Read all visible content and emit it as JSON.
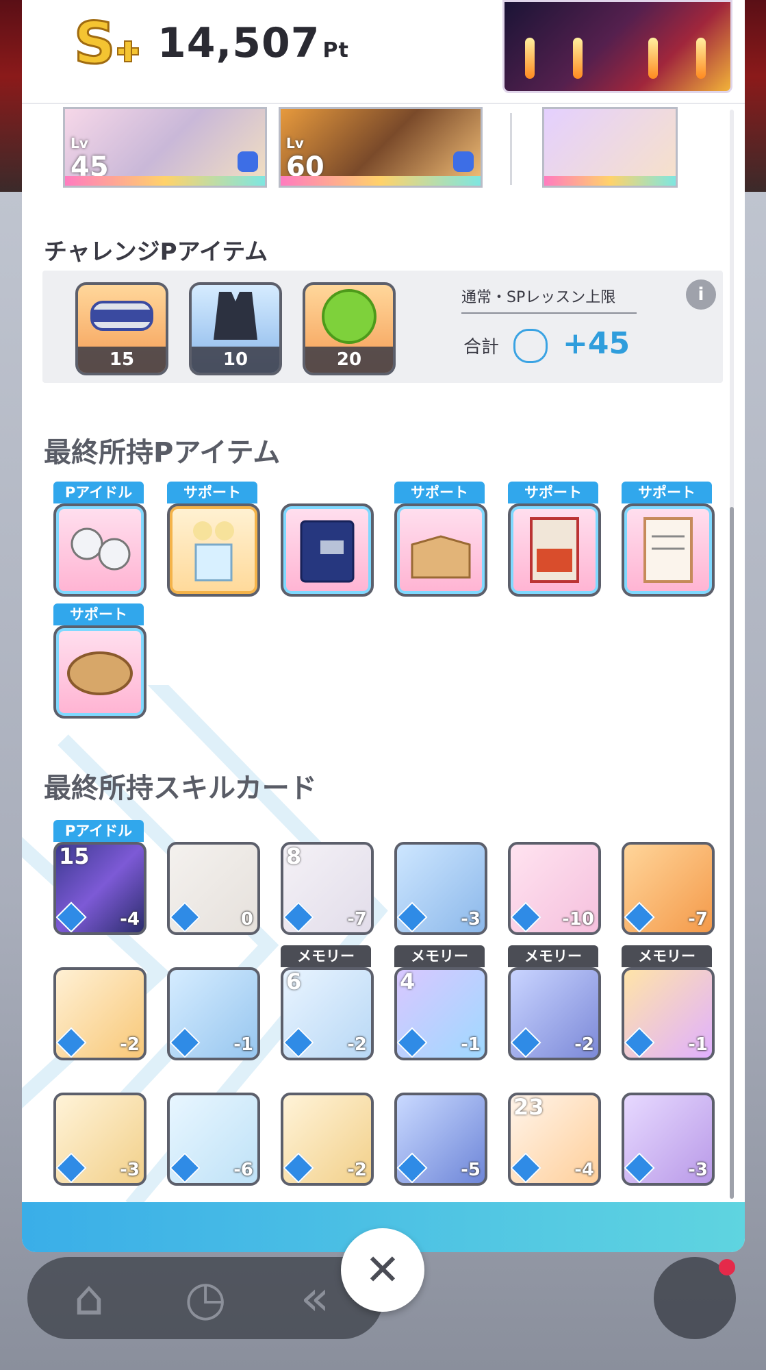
{
  "header": {
    "rank": "S+",
    "points": "14,507",
    "points_unit": "Pt"
  },
  "card_strip": [
    {
      "lv_label": "Lv",
      "level": "45"
    },
    {
      "lv_label": "Lv",
      "level": "60"
    }
  ],
  "challenge": {
    "title": "チャレンジPアイテム",
    "items": [
      {
        "count": "15"
      },
      {
        "count": "10"
      },
      {
        "count": "20"
      }
    ],
    "limit_label": "通常・SPレッスン上限",
    "total_label": "合計",
    "total_value": "+45"
  },
  "final_items": {
    "title": "最終所持Pアイテム",
    "labels": [
      "Pアイドル",
      "サポート",
      "",
      "サポート",
      "サポート",
      "サポート",
      "サポート"
    ]
  },
  "final_skills": {
    "title": "最終所持スキルカード",
    "top_labels": [
      "Pアイドル",
      "メモリー",
      "メモリー",
      "メモリー",
      "メモリー"
    ],
    "cards": [
      {
        "lvl": "15",
        "cost": "-4"
      },
      {
        "lvl": "",
        "cost": "0"
      },
      {
        "lvl": "8",
        "cost": "-7"
      },
      {
        "lvl": "",
        "cost": "-3"
      },
      {
        "lvl": "",
        "cost": "-10"
      },
      {
        "lvl": "",
        "cost": "-7"
      },
      {
        "lvl": "",
        "cost": "-2"
      },
      {
        "lvl": "",
        "cost": "-1"
      },
      {
        "lvl": "6",
        "cost": "-2"
      },
      {
        "lvl": "4",
        "cost": "-1"
      },
      {
        "lvl": "",
        "cost": "-2"
      },
      {
        "lvl": "",
        "cost": "-1"
      },
      {
        "lvl": "",
        "cost": "-3"
      },
      {
        "lvl": "",
        "cost": "-6"
      },
      {
        "lvl": "",
        "cost": "-2"
      },
      {
        "lvl": "",
        "cost": "-5"
      },
      {
        "lvl": "23",
        "cost": "-4"
      },
      {
        "lvl": "",
        "cost": "-3"
      }
    ]
  },
  "colors": {
    "accent": "#2f9ddc",
    "support_label": "#31a7ec",
    "memory_label": "#4b4d55"
  },
  "icons": {
    "close": "close-icon",
    "info": "info-icon",
    "home": "home-icon"
  },
  "close_glyph": "✕",
  "info_glyph": "i"
}
